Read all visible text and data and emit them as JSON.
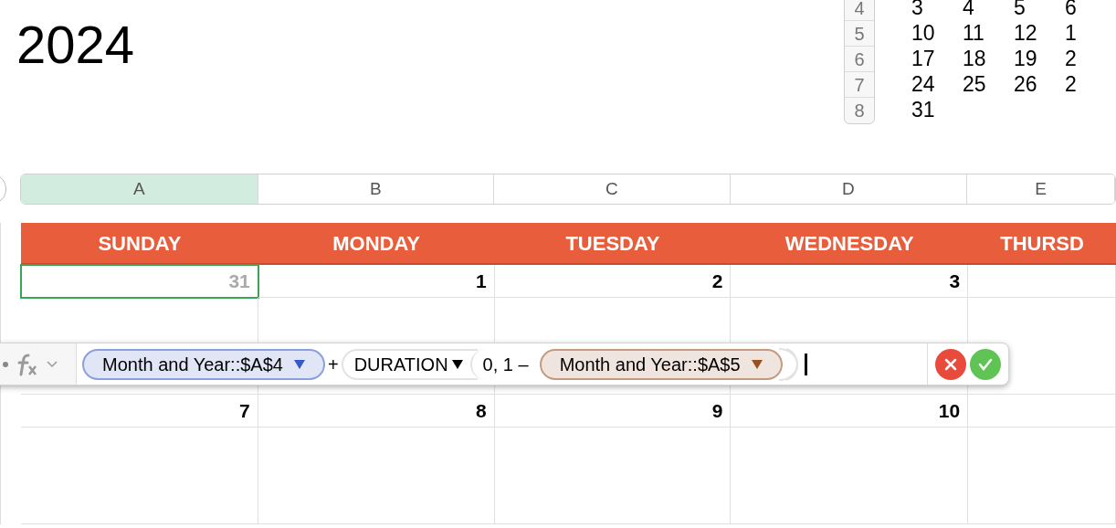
{
  "title": "2024",
  "mini_table": {
    "row_headers": [
      "4",
      "5",
      "6",
      "7",
      "8"
    ],
    "rows": [
      [
        "3",
        "4",
        "5",
        "6"
      ],
      [
        "10",
        "11",
        "12",
        "1"
      ],
      [
        "17",
        "18",
        "19",
        "2"
      ],
      [
        "24",
        "25",
        "26",
        "2"
      ],
      [
        "31"
      ]
    ]
  },
  "column_headers": [
    {
      "label": "A",
      "selected": true
    },
    {
      "label": "B",
      "selected": false
    },
    {
      "label": "C",
      "selected": false
    },
    {
      "label": "D",
      "selected": false
    },
    {
      "label": "E",
      "selected": false
    }
  ],
  "day_headers": [
    "SUNDAY",
    "MONDAY",
    "TUESDAY",
    "WEDNESDAY",
    "THURSD"
  ],
  "weeks": [
    {
      "cells": [
        {
          "day": "31",
          "muted": true,
          "selected": true
        },
        {
          "day": "1",
          "muted": false,
          "selected": false
        },
        {
          "day": "2",
          "muted": false,
          "selected": false
        },
        {
          "day": "3",
          "muted": false,
          "selected": false
        },
        {
          "selected": false
        }
      ]
    },
    {
      "cells": [
        {
          "day": "7",
          "muted": false,
          "selected": false
        },
        {
          "day": "8",
          "muted": false,
          "selected": false
        },
        {
          "day": "9",
          "muted": false,
          "selected": false
        },
        {
          "day": "10",
          "muted": false,
          "selected": false
        },
        {
          "selected": false
        }
      ]
    }
  ],
  "formula_bar": {
    "tokens": [
      {
        "kind": "ref",
        "text": "Month and Year::$A$4",
        "color": "#3559c9"
      },
      {
        "kind": "op",
        "text": "+"
      },
      {
        "kind": "func",
        "text": "DURATION"
      },
      {
        "kind": "args",
        "text": "0, 1 –"
      },
      {
        "kind": "ref",
        "text": "Month and Year::$A$5",
        "color": "#9a4f1f"
      },
      {
        "kind": "close"
      }
    ]
  }
}
